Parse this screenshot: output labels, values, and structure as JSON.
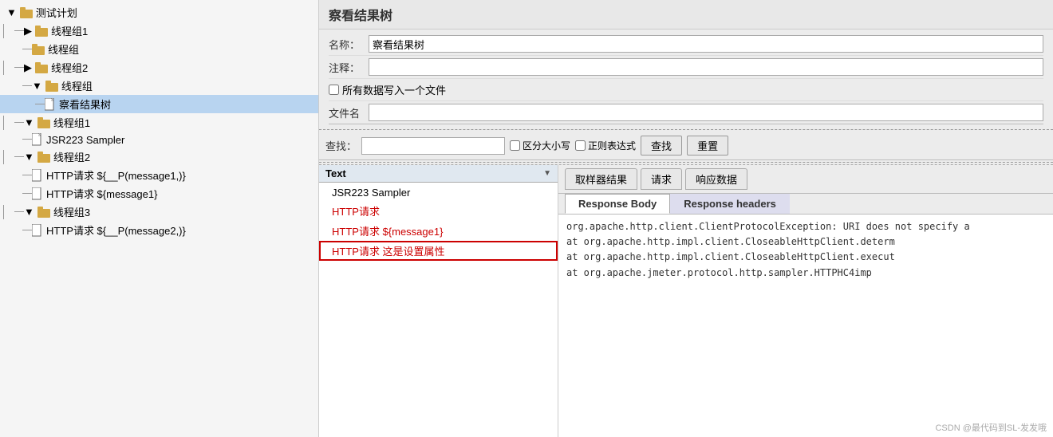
{
  "title": "察看结果树",
  "form": {
    "name_label": "名称：",
    "name_value": "察看结果树",
    "comment_label": "注释：",
    "comment_value": "",
    "write_all_label": "所有数据写入一个文件",
    "filename_label": "文件名"
  },
  "search": {
    "label": "查找：",
    "placeholder": "",
    "case_label": "区分大小写",
    "regex_label": "正则表达式",
    "find_btn": "查找",
    "reset_btn": "重置"
  },
  "list": {
    "header": "Text",
    "items": [
      {
        "label": "JSR223 Sampler",
        "color": "normal"
      },
      {
        "label": "HTTP请求",
        "color": "red"
      },
      {
        "label": "HTTP请求 ${message1}",
        "color": "red"
      },
      {
        "label": "HTTP请求 这是设置属性",
        "color": "red",
        "selected": true
      }
    ]
  },
  "tabs": {
    "tab1": "取样器结果",
    "tab2": "请求",
    "tab3": "响应数据"
  },
  "sub_tabs": {
    "body": "Response Body",
    "headers": "Response headers"
  },
  "error_lines": [
    "org.apache.http.client.ClientProtocolException: URI does not specify a",
    "    at org.apache.http.impl.client.CloseableHttpClient.determ",
    "    at org.apache.http.impl.client.CloseableHttpClient.execut",
    "    at org.apache.jmeter.protocol.http.sampler.HTTPHC4imp"
  ],
  "tree": {
    "root": "测试计划",
    "items": [
      {
        "label": "线程组1",
        "level": 1,
        "type": "folder"
      },
      {
        "label": "线程组",
        "level": 2,
        "type": "folder"
      },
      {
        "label": "线程组2",
        "level": 1,
        "type": "folder"
      },
      {
        "label": "线程组",
        "level": 2,
        "type": "folder"
      },
      {
        "label": "察看结果树",
        "level": 3,
        "type": "doc",
        "selected": true
      },
      {
        "label": "线程组1",
        "level": 1,
        "type": "folder"
      },
      {
        "label": "JSR223 Sampler",
        "level": 2,
        "type": "doc"
      },
      {
        "label": "线程组2",
        "level": 1,
        "type": "folder"
      },
      {
        "label": "HTTP请求 ${__P(message1,)}",
        "level": 2,
        "type": "doc"
      },
      {
        "label": "HTTP请求 ${message1}",
        "level": 2,
        "type": "doc"
      },
      {
        "label": "线程组3",
        "level": 1,
        "type": "folder"
      },
      {
        "label": "HTTP请求 ${__P(message2,)}",
        "level": 2,
        "type": "doc"
      }
    ]
  },
  "watermark": "CSDN @最代码到SL-发发哦"
}
